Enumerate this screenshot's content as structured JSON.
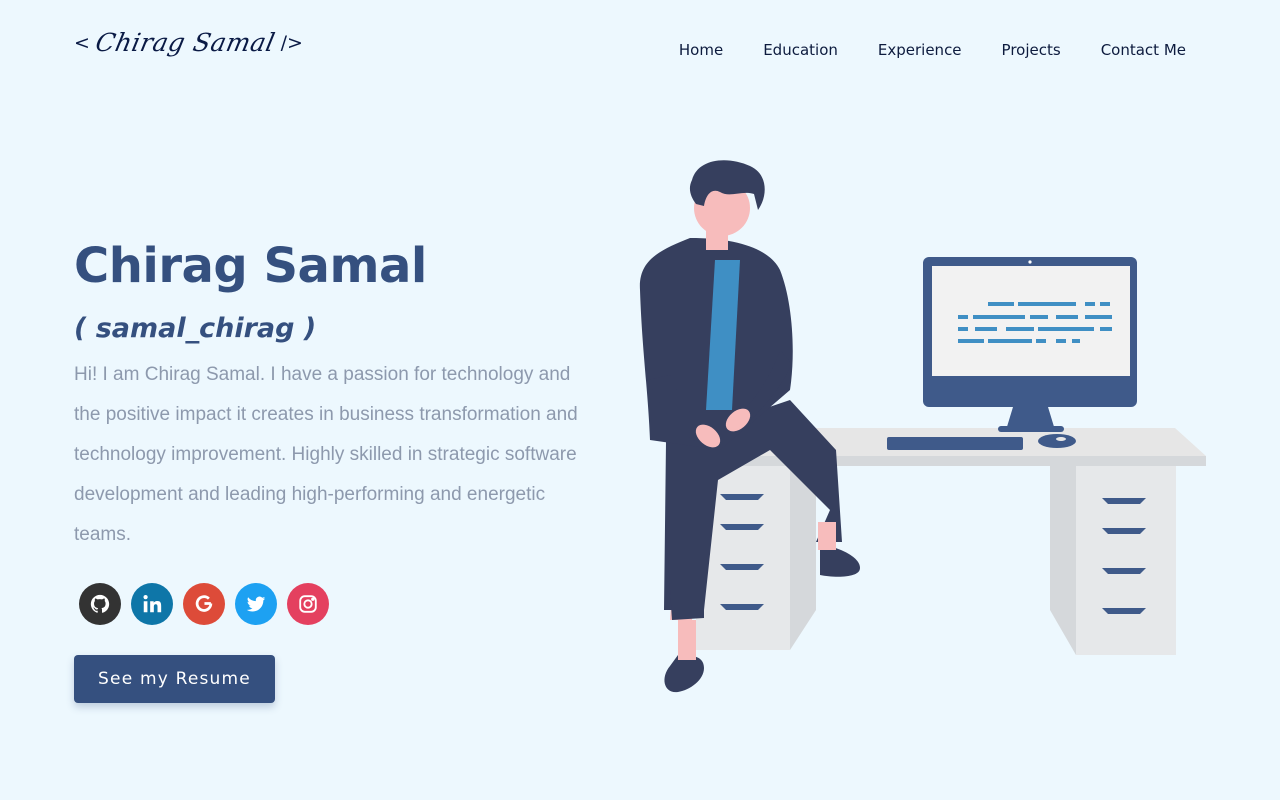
{
  "header": {
    "logo_open": "<",
    "logo_signature": "Chirag Samal",
    "logo_close": "/>",
    "nav": [
      "Home",
      "Education",
      "Experience",
      "Projects",
      "Contact Me"
    ]
  },
  "hero": {
    "name": "Chirag Samal",
    "handle": "( samal_chirag )",
    "bio": "Hi! I am Chirag Samal. I have a passion for technology and the positive impact it creates in business transformation and technology improvement. Highly skilled in strategic software development and leading high-performing and energetic teams.",
    "resume_button": "See my Resume"
  },
  "social": [
    {
      "name": "github-icon",
      "color": "#333333"
    },
    {
      "name": "linkedin-icon",
      "color": "#0e76a8"
    },
    {
      "name": "google-icon",
      "color": "#dd4b39"
    },
    {
      "name": "twitter-icon",
      "color": "#1da1f2"
    },
    {
      "name": "instagram-icon",
      "color": "#e4405f"
    }
  ],
  "colors": {
    "background": "#edf8fe",
    "primary": "#35507f",
    "bio_text": "#8d99ad"
  }
}
